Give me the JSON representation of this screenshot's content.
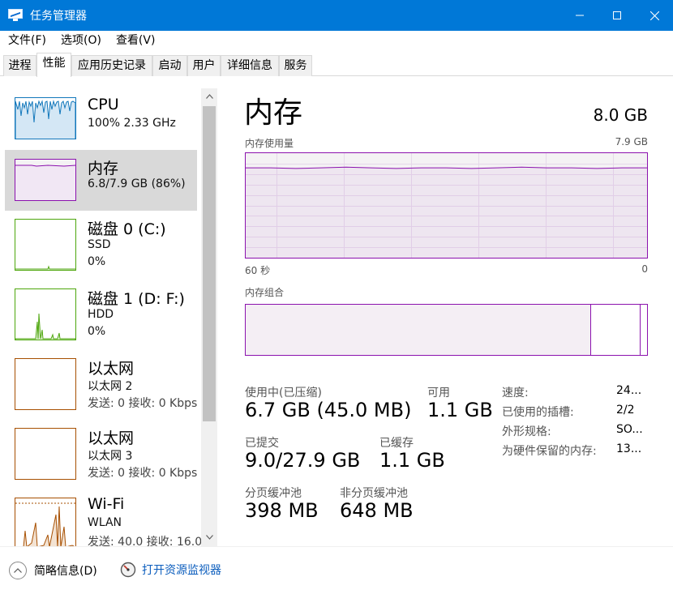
{
  "window": {
    "title": "任务管理器"
  },
  "menu": [
    {
      "label": "文件(F)"
    },
    {
      "label": "选项(O)"
    },
    {
      "label": "查看(V)"
    }
  ],
  "tabs": [
    {
      "label": "进程"
    },
    {
      "label": "性能",
      "active": true
    },
    {
      "label": "应用历史记录"
    },
    {
      "label": "启动"
    },
    {
      "label": "用户"
    },
    {
      "label": "详细信息"
    },
    {
      "label": "服务"
    }
  ],
  "sidebar": {
    "items": [
      {
        "title": "CPU",
        "line1": "100%  2.33 GHz",
        "line2": "",
        "color": "#1177bb"
      },
      {
        "title": "内存",
        "line1": "6.8/7.9 GB (86%)",
        "line2": "",
        "color": "#8b12ae",
        "selected": true
      },
      {
        "title": "磁盘 0 (C:)",
        "line1": "SSD",
        "line2": "0%",
        "color": "#4da60c"
      },
      {
        "title": "磁盘 1 (D: F:)",
        "line1": "HDD",
        "line2": "0%",
        "color": "#4da60c"
      },
      {
        "title": "以太网",
        "line1": "以太网 2",
        "line2": "发送: 0 接收: 0 Kbps",
        "color": "#a74f01"
      },
      {
        "title": "以太网",
        "line1": "以太网 3",
        "line2": "发送: 0 接收: 0 Kbps",
        "color": "#a74f01"
      },
      {
        "title": "Wi-Fi",
        "line1": "WLAN",
        "line2": "发送: 40.0 接收: 16.0",
        "color": "#a74f01"
      }
    ]
  },
  "memory": {
    "title": "内存",
    "total": "8.0 GB",
    "usage_graph": {
      "label": "内存使用量",
      "max": "7.9 GB",
      "x_left": "60 秒",
      "x_right": "0",
      "level": 0.86
    },
    "composition": {
      "label": "内存组合",
      "in_use_fraction": 0.86,
      "modified_fraction": 0.005,
      "standby_fraction": 0.13
    },
    "stats": {
      "in_use_label": "使用中(已压缩)",
      "in_use_value": "6.7 GB (45.0 MB)",
      "available_label": "可用",
      "available_value": "1.1 GB",
      "committed_label": "已提交",
      "committed_value": "9.0/27.9 GB",
      "cached_label": "已缓存",
      "cached_value": "1.1 GB",
      "paged_label": "分页缓冲池",
      "paged_value": "398 MB",
      "nonpaged_label": "非分页缓冲池",
      "nonpaged_value": "648 MB"
    },
    "details": [
      {
        "key": "速度:",
        "value": "24..."
      },
      {
        "key": "已使用的插槽:",
        "value": "2/2"
      },
      {
        "key": "外形规格:",
        "value": "SO..."
      },
      {
        "key": "为硬件保留的内存:",
        "value": "13..."
      }
    ]
  },
  "footer": {
    "fewer_details": "简略信息(D)",
    "resource_monitor": "打开资源监视器"
  },
  "colors": {
    "titlebar": "#0078d7",
    "memory_accent": "#8b12ae",
    "link": "#0b5dbd"
  }
}
